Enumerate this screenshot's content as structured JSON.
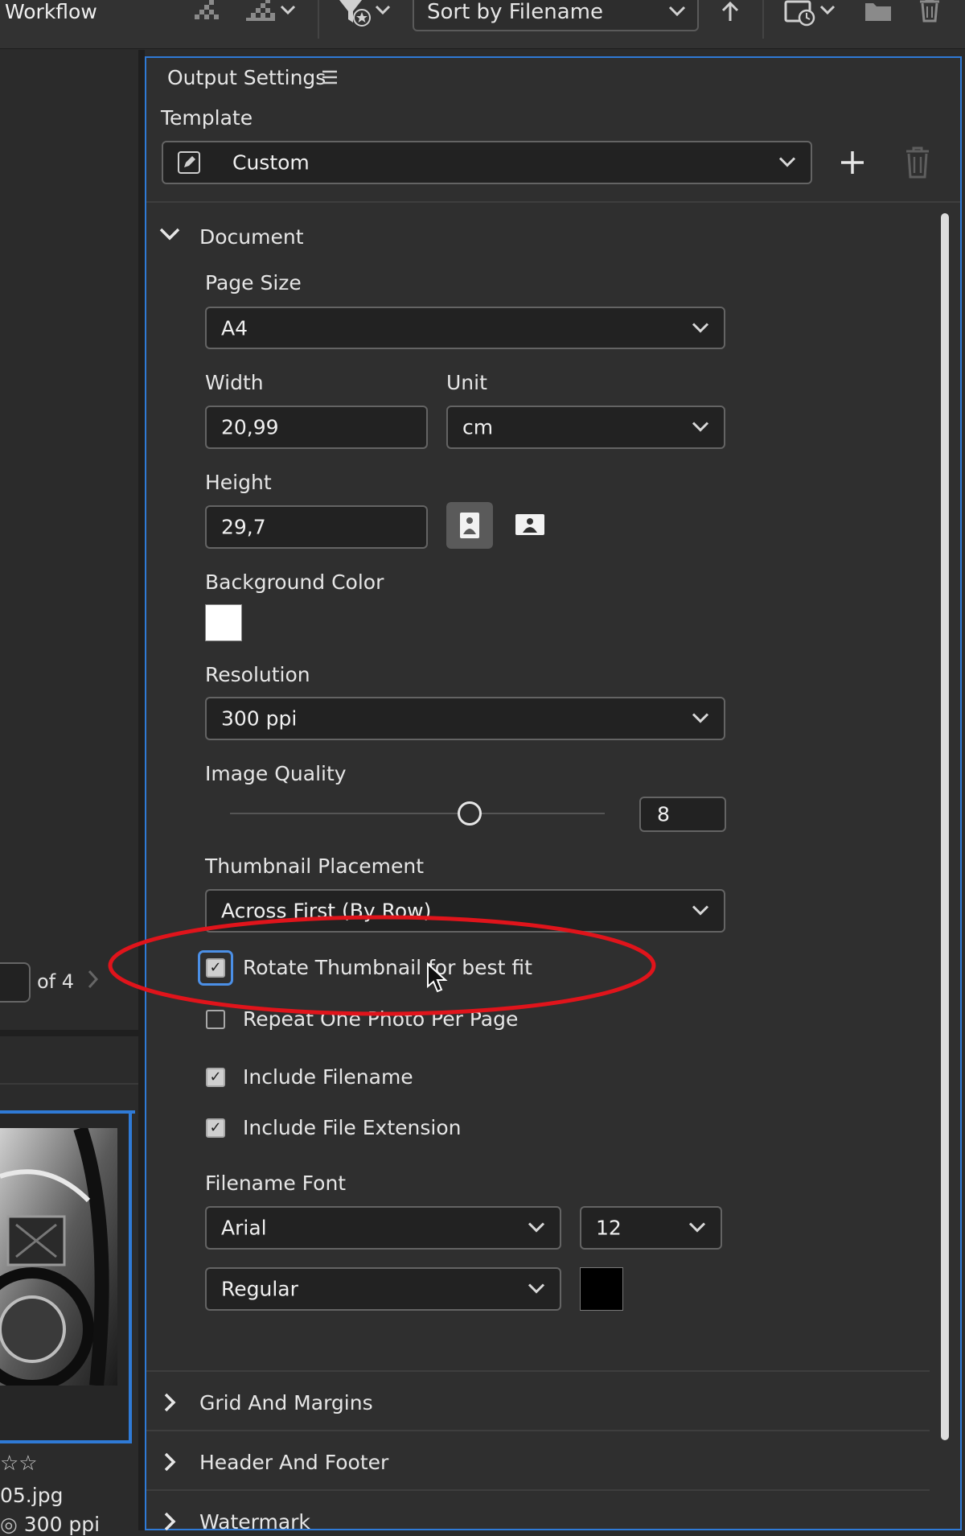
{
  "topbar": {
    "workflow": "Workflow",
    "sort_label": "Sort by Filename"
  },
  "left": {
    "page_of": "of 4",
    "file_suffix": "05.jpg",
    "resolution_suffix": "300 ppi",
    "stars": "☆☆"
  },
  "panel": {
    "title": "Output Settings",
    "template_label": "Template",
    "template_value": "Custom"
  },
  "document": {
    "section_label": "Document",
    "page_size_label": "Page Size",
    "page_size_value": "A4",
    "width_label": "Width",
    "width_value": "20,99",
    "unit_label": "Unit",
    "unit_value": "cm",
    "height_label": "Height",
    "height_value": "29,7",
    "bg_color_label": "Background Color",
    "bg_color": "#ffffff",
    "resolution_label": "Resolution",
    "resolution_value": "300 ppi",
    "quality_label": "Image Quality",
    "quality_value": "8",
    "quality_fraction": 0.64,
    "placement_label": "Thumbnail Placement",
    "placement_value": "Across First (By Row)",
    "rotate_label": "Rotate Thumbnail for best fit",
    "repeat_label": "Repeat One Photo Per Page",
    "include_filename_label": "Include Filename",
    "include_ext_label": "Include File Extension",
    "font_label": "Filename Font",
    "font_value": "Arial",
    "font_size_value": "12",
    "font_style_value": "Regular",
    "font_color": "#000000"
  },
  "sections": {
    "grid": "Grid And Margins",
    "header": "Header And Footer",
    "watermark": "Watermark"
  },
  "colors": {
    "accent": "#2f7ad6",
    "annotation": "#e0141b"
  }
}
